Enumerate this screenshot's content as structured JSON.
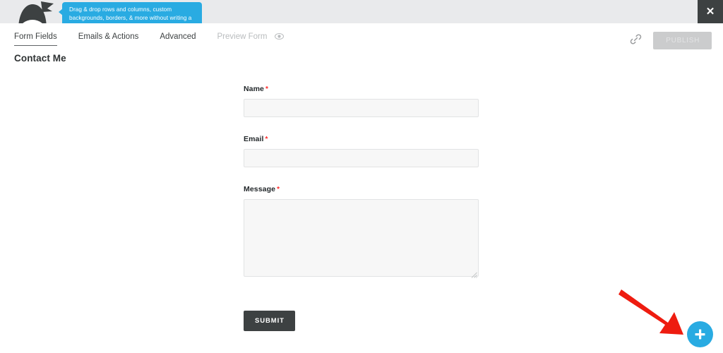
{
  "topbar": {
    "logo_name": "ninja-forms-logo",
    "tooltip_text": "Drag & drop rows and columns, custom backgrounds, borders, & more without writing a single line of code.",
    "close_label": "✕"
  },
  "header": {
    "tabs": [
      {
        "label": "Form Fields",
        "state": "active"
      },
      {
        "label": "Emails & Actions",
        "state": "default"
      },
      {
        "label": "Advanced",
        "state": "default"
      },
      {
        "label": "Preview Form",
        "state": "muted",
        "icon": "eye-icon"
      }
    ],
    "link_icon": "chain-link-icon",
    "publish_label": "PUBLISH"
  },
  "form": {
    "title": "Contact Me",
    "fields": [
      {
        "label": "Name",
        "required": "*",
        "type": "text",
        "value": "",
        "placeholder": ""
      },
      {
        "label": "Email",
        "required": "*",
        "type": "text",
        "value": "",
        "placeholder": ""
      },
      {
        "label": "Message",
        "required": "*",
        "type": "textarea",
        "value": "",
        "placeholder": ""
      }
    ],
    "submit_label": "SUBMIT"
  },
  "annotation": {
    "arrow_name": "red-pointer-arrow",
    "arrow_color": "#ee1c10"
  },
  "fab": {
    "label": "+",
    "name": "add-field-button",
    "color": "#29abe2"
  },
  "colors": {
    "topbar_bg": "#e9eaec",
    "dark": "#3d4142",
    "accent_blue": "#29abe2",
    "required_red": "#ff2a2a",
    "field_bg": "#f7f7f7",
    "field_border": "#e2e3e4",
    "publish_bg": "#cbcccd"
  }
}
